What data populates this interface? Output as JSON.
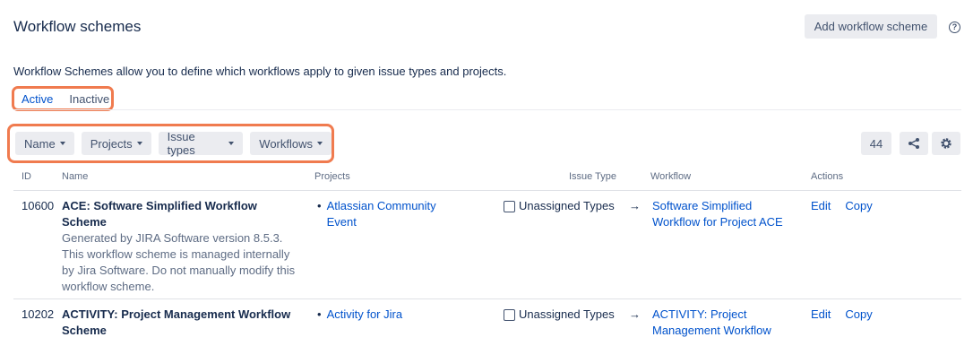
{
  "header": {
    "title": "Workflow schemes",
    "add_label": "Add workflow scheme",
    "help_glyph": "?"
  },
  "description": "Workflow Schemes allow you to define which workflows apply to given issue types and projects.",
  "state_tabs": [
    "Active",
    "Inactive"
  ],
  "filters": [
    "Name",
    "Projects",
    "Issue types",
    "Workflows"
  ],
  "count": "44",
  "columns": [
    "ID",
    "Name",
    "Projects",
    "Issue Type",
    "Workflow",
    "Actions"
  ],
  "rows": [
    {
      "id": "10600",
      "name": "ACE: Software Simplified Workflow Scheme",
      "description": "Generated by JIRA Software version 8.5.3. This workflow scheme is managed internally by Jira Software. Do not manually modify this workflow scheme.",
      "project": "Atlassian Community Event",
      "issue_type": "Unassigned Types",
      "arrow": "→",
      "workflow": "Software Simplified Workflow for Project ACE",
      "actions": [
        "Edit",
        "Copy"
      ]
    },
    {
      "id": "10202",
      "name": "ACTIVITY: Project Management Workflow Scheme",
      "description": "",
      "project": "Activity for Jira",
      "issue_type": "Unassigned Types",
      "arrow": "→",
      "workflow": "ACTIVITY: Project Management Workflow",
      "actions": [
        "Edit",
        "Copy"
      ]
    }
  ],
  "colors": {
    "accent": "#0052cc",
    "highlight": "#f07b4f",
    "button_bg": "#ebecf0",
    "text": "#172b4d",
    "muted": "#5e6c84"
  }
}
